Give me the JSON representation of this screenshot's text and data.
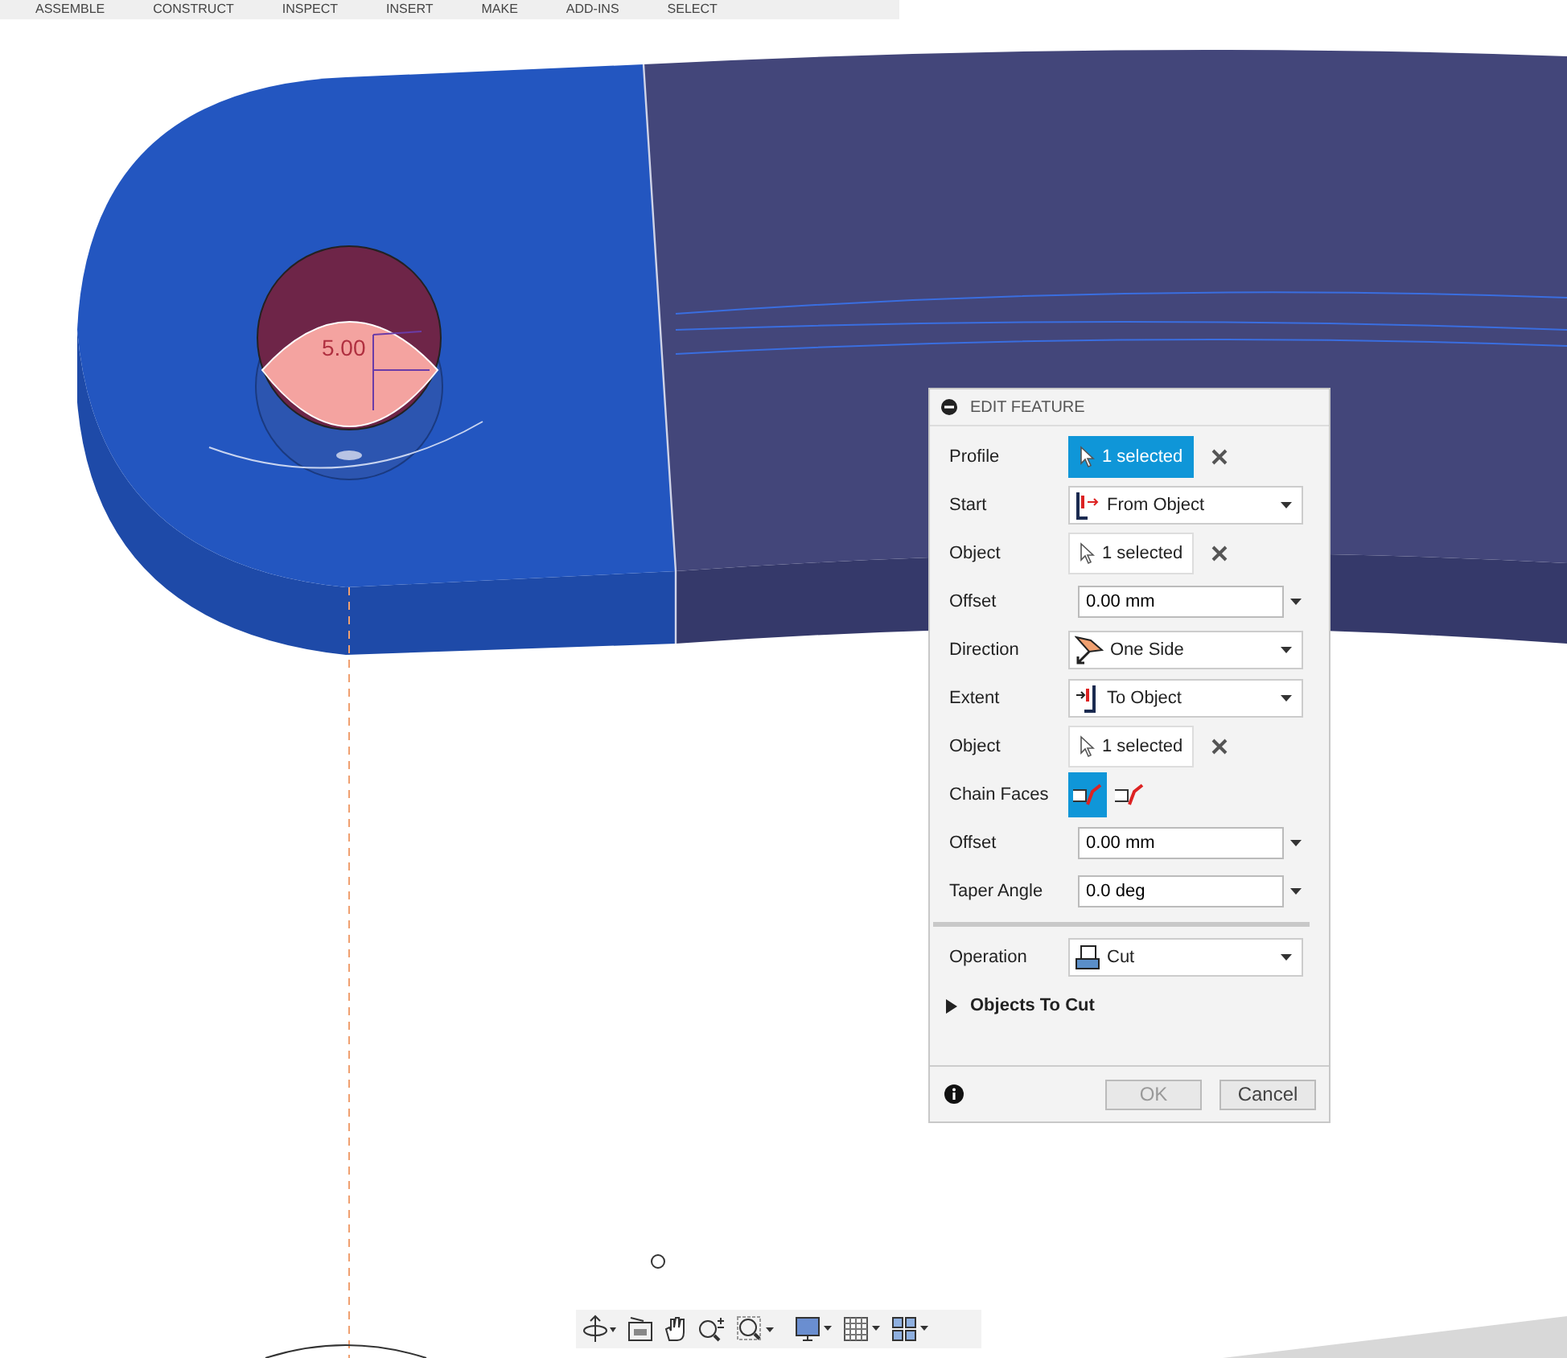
{
  "toolbar": {
    "tabs": [
      {
        "label": "ASSEMBLE"
      },
      {
        "label": "CONSTRUCT"
      },
      {
        "label": "INSPECT"
      },
      {
        "label": "INSERT"
      },
      {
        "label": "MAKE"
      },
      {
        "label": "ADD-INS"
      },
      {
        "label": "SELECT"
      }
    ]
  },
  "dimension": {
    "value": "5.00"
  },
  "edit_feature": {
    "title": "EDIT FEATURE",
    "rows": [
      {
        "kind": "selection",
        "label": "Profile",
        "value": "1 selected",
        "active": true
      },
      {
        "kind": "dropdown",
        "label": "Start",
        "value": "From Object"
      },
      {
        "kind": "selection",
        "label": "Object",
        "value": "1 selected",
        "active": false
      },
      {
        "kind": "input",
        "label": "Offset",
        "value": "0.00 mm"
      },
      {
        "kind": "dropdown",
        "label": "Direction",
        "value": "One Side"
      },
      {
        "kind": "dropdown",
        "label": "Extent",
        "value": "To Object"
      },
      {
        "kind": "selection",
        "label": "Object",
        "value": "1 selected",
        "active": false
      },
      {
        "kind": "toggle",
        "label": "Chain Faces",
        "options": [
          {
            "selected": true
          },
          {
            "selected": false
          }
        ]
      },
      {
        "kind": "input",
        "label": "Offset",
        "value": "0.00 mm"
      },
      {
        "kind": "input",
        "label": "Taper Angle",
        "value": "0.0 deg"
      },
      {
        "kind": "separator"
      },
      {
        "kind": "dropdown",
        "label": "Operation",
        "value": "Cut"
      },
      {
        "kind": "section",
        "label": "Objects To Cut",
        "expanded": false
      }
    ],
    "buttons": [
      {
        "label": "OK",
        "disabled": true
      },
      {
        "label": "Cancel",
        "disabled": false
      }
    ]
  }
}
